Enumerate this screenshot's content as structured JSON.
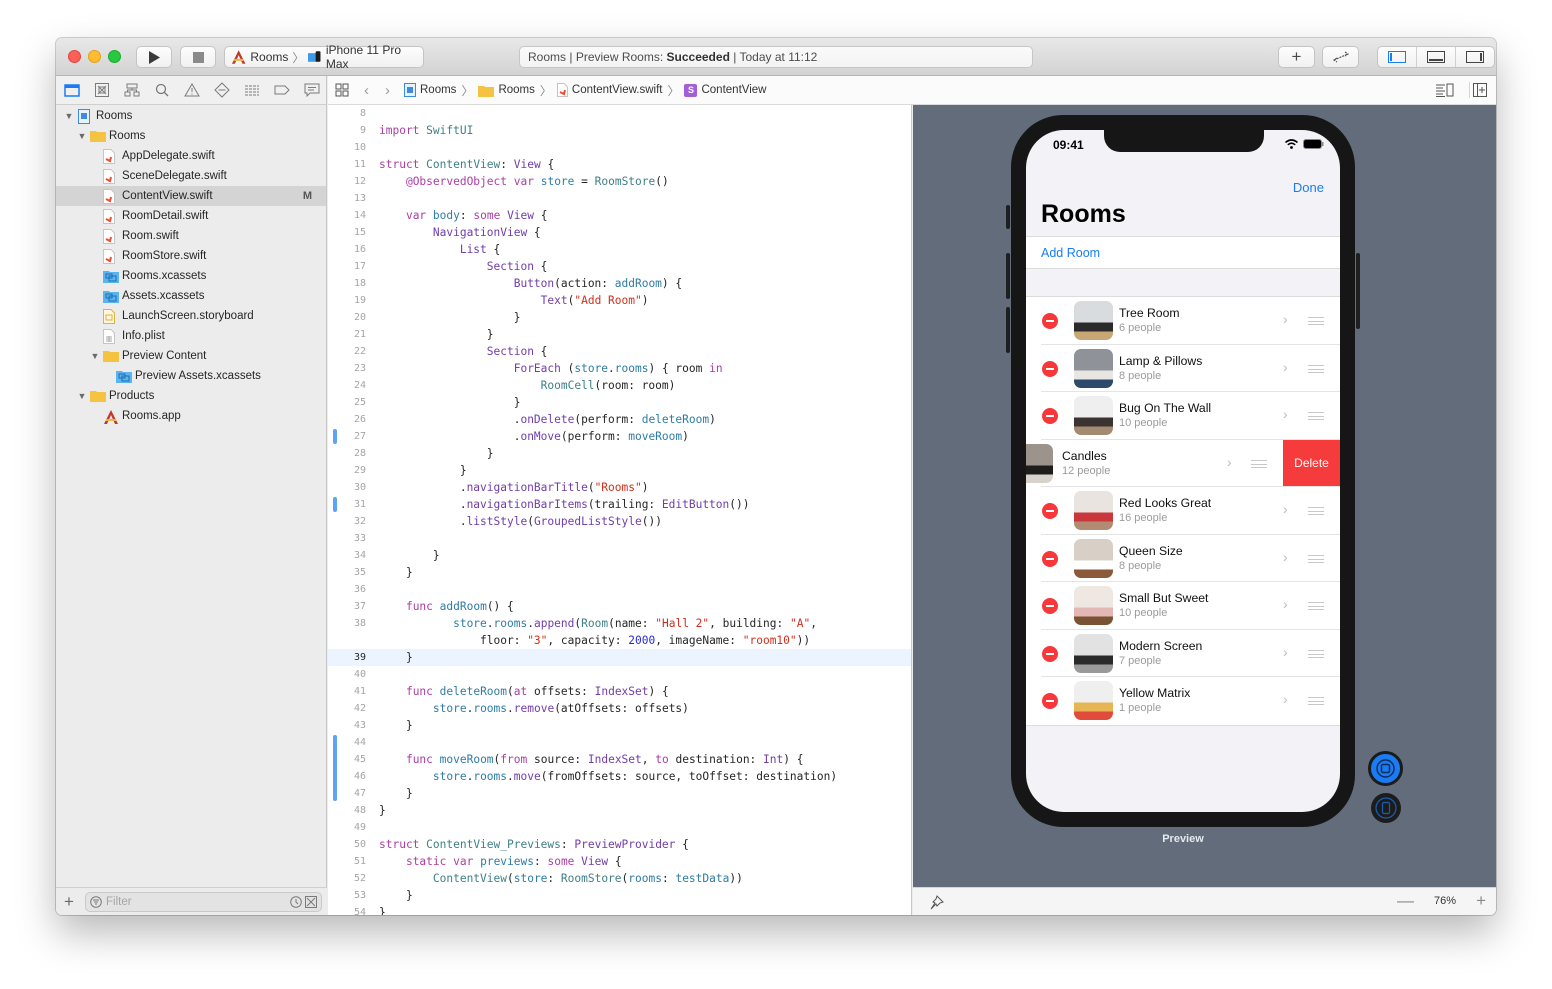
{
  "toolbar": {
    "run_label": "Run",
    "stop_label": "Stop",
    "scheme": {
      "project": "Rooms",
      "device": "iPhone 11 Pro Max"
    },
    "status": {
      "project": "Rooms",
      "prefix": "Preview Rooms:",
      "result": "Succeeded",
      "time": "Today at 11:12",
      "sep": "|"
    },
    "library_button": "+",
    "code_review_button": "⇄",
    "panels": [
      "navigator",
      "debug-area",
      "inspectors"
    ]
  },
  "navigator": {
    "tabs": [
      "project",
      "source-control",
      "symbols",
      "find",
      "issues",
      "tests",
      "debug",
      "breakpoints",
      "reports"
    ],
    "tree": [
      {
        "label": "Rooms",
        "type": "project",
        "depth": 0,
        "open": true
      },
      {
        "label": "Rooms",
        "type": "folder",
        "depth": 1,
        "open": true
      },
      {
        "label": "AppDelegate.swift",
        "type": "swift",
        "depth": 2
      },
      {
        "label": "SceneDelegate.swift",
        "type": "swift",
        "depth": 2
      },
      {
        "label": "ContentView.swift",
        "type": "swift",
        "depth": 2,
        "selected": true,
        "badge": "M"
      },
      {
        "label": "RoomDetail.swift",
        "type": "swift",
        "depth": 2
      },
      {
        "label": "Room.swift",
        "type": "swift",
        "depth": 2
      },
      {
        "label": "RoomStore.swift",
        "type": "swift",
        "depth": 2
      },
      {
        "label": "Rooms.xcassets",
        "type": "assets",
        "depth": 2
      },
      {
        "label": "Assets.xcassets",
        "type": "assets",
        "depth": 2
      },
      {
        "label": "LaunchScreen.storyboard",
        "type": "storyboard",
        "depth": 2
      },
      {
        "label": "Info.plist",
        "type": "plist",
        "depth": 2
      },
      {
        "label": "Preview Content",
        "type": "folder",
        "depth": 2,
        "open": true
      },
      {
        "label": "Preview Assets.xcassets",
        "type": "assets",
        "depth": 3
      },
      {
        "label": "Products",
        "type": "folder",
        "depth": 1,
        "open": true
      },
      {
        "label": "Rooms.app",
        "type": "app",
        "depth": 2
      }
    ],
    "filter_placeholder": "Filter",
    "add_label": "+"
  },
  "jumpbar": {
    "crumbs": [
      "Rooms",
      "Rooms",
      "ContentView.swift",
      "ContentView"
    ],
    "symbol_badge": "S"
  },
  "editor": {
    "current_line": 39,
    "changed_lines": [
      27,
      31,
      44,
      45,
      46,
      47
    ],
    "lines": [
      {
        "n": "8",
        "t": ""
      },
      {
        "n": "9",
        "t": "import SwiftUI"
      },
      {
        "n": "10",
        "t": ""
      },
      {
        "n": "11",
        "t": "struct ContentView: View {"
      },
      {
        "n": "12",
        "t": "    @ObservedObject var store = RoomStore()"
      },
      {
        "n": "13",
        "t": ""
      },
      {
        "n": "14",
        "t": "    var body: some View {"
      },
      {
        "n": "15",
        "t": "        NavigationView {"
      },
      {
        "n": "16",
        "t": "            List {"
      },
      {
        "n": "17",
        "t": "                Section {"
      },
      {
        "n": "18",
        "t": "                    Button(action: addRoom) {"
      },
      {
        "n": "19",
        "t": "                        Text(\"Add Room\")"
      },
      {
        "n": "20",
        "t": "                    }"
      },
      {
        "n": "21",
        "t": "                }"
      },
      {
        "n": "22",
        "t": "                Section {"
      },
      {
        "n": "23",
        "t": "                    ForEach (store.rooms) { room in"
      },
      {
        "n": "24",
        "t": "                        RoomCell(room: room)"
      },
      {
        "n": "25",
        "t": "                    }"
      },
      {
        "n": "26",
        "t": "                    .onDelete(perform: deleteRoom)"
      },
      {
        "n": "27",
        "t": "                    .onMove(perform: moveRoom)"
      },
      {
        "n": "28",
        "t": "                }"
      },
      {
        "n": "29",
        "t": "            }"
      },
      {
        "n": "30",
        "t": "            .navigationBarTitle(\"Rooms\")"
      },
      {
        "n": "31",
        "t": "            .navigationBarItems(trailing: EditButton())"
      },
      {
        "n": "32",
        "t": "            .listStyle(GroupedListStyle())"
      },
      {
        "n": "33",
        "t": ""
      },
      {
        "n": "34",
        "t": "        }"
      },
      {
        "n": "35",
        "t": "    }"
      },
      {
        "n": "36",
        "t": ""
      },
      {
        "n": "37",
        "t": "    func addRoom() {"
      },
      {
        "n": "38",
        "t": "           store.rooms.append(Room(name: \"Hall 2\", building: \"A\","
      },
      {
        "n": "",
        "t": "               floor: \"3\", capacity: 2000, imageName: \"room10\"))"
      },
      {
        "n": "39",
        "t": "    }"
      },
      {
        "n": "40",
        "t": ""
      },
      {
        "n": "41",
        "t": "    func deleteRoom(at offsets: IndexSet) {"
      },
      {
        "n": "42",
        "t": "        store.rooms.remove(atOffsets: offsets)"
      },
      {
        "n": "43",
        "t": "    }"
      },
      {
        "n": "44",
        "t": ""
      },
      {
        "n": "45",
        "t": "    func moveRoom(from source: IndexSet, to destination: Int) {"
      },
      {
        "n": "46",
        "t": "        store.rooms.move(fromOffsets: source, toOffset: destination)"
      },
      {
        "n": "47",
        "t": "    }"
      },
      {
        "n": "48",
        "t": "}"
      },
      {
        "n": "49",
        "t": ""
      },
      {
        "n": "50",
        "t": "struct ContentView_Previews: PreviewProvider {"
      },
      {
        "n": "51",
        "t": "    static var previews: some View {"
      },
      {
        "n": "52",
        "t": "        ContentView(store: RoomStore(rooms: testData))"
      },
      {
        "n": "53",
        "t": "    }"
      },
      {
        "n": "54",
        "t": "}"
      }
    ]
  },
  "preview": {
    "status_time": "09:41",
    "done_label": "Done",
    "nav_title": "Rooms",
    "add_room_label": "Add Room",
    "delete_label": "Delete",
    "swiped_index": 3,
    "rooms": [
      {
        "name": "Tree Room",
        "capacity": "6 people",
        "thumb": [
          "#d9dcdf",
          "#2a2a2a",
          "#c9a774"
        ]
      },
      {
        "name": "Lamp & Pillows",
        "capacity": "8 people",
        "thumb": [
          "#8f9399",
          "#e8e6e2",
          "#2e4a6b"
        ]
      },
      {
        "name": "Bug On The Wall",
        "capacity": "10 people",
        "thumb": [
          "#efefef",
          "#3b3232",
          "#a58a72"
        ]
      },
      {
        "name": "Candles",
        "capacity": "12 people",
        "thumb": [
          "#9c948c",
          "#1d1d1d",
          "#d7d2cb"
        ]
      },
      {
        "name": "Red Looks Great",
        "capacity": "16 people",
        "thumb": [
          "#e9e4df",
          "#c9363b",
          "#b28c72"
        ]
      },
      {
        "name": "Queen Size",
        "capacity": "8 people",
        "thumb": [
          "#d8d0c6",
          "#ffffff",
          "#8a5a3b"
        ]
      },
      {
        "name": "Small But Sweet",
        "capacity": "10 people",
        "thumb": [
          "#efe8e2",
          "#e3b7b3",
          "#7a5335"
        ]
      },
      {
        "name": "Modern Screen",
        "capacity": "7 people",
        "thumb": [
          "#e2e2e2",
          "#2a2a2a",
          "#9a9a9a"
        ]
      },
      {
        "name": "Yellow Matrix",
        "capacity": "1 people",
        "thumb": [
          "#efefef",
          "#e7b654",
          "#e24a3c"
        ]
      }
    ],
    "label": "Preview",
    "zoom_level": "76%",
    "zoom_out": "—",
    "zoom_in": "+"
  },
  "colors": {
    "accent": "#1a7cf4",
    "destructive": "#f53b3c",
    "canvas_bg": "#626c7a"
  }
}
